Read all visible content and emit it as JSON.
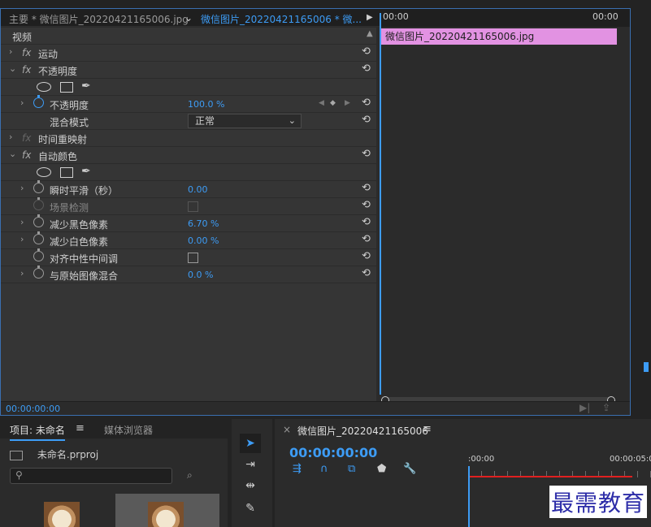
{
  "ec_tabs": {
    "master": "主要 * 微信图片_20220421165006.jpg",
    "sequence": "微信图片_20220421165006 * 微...",
    "dropdown_arrow": "⌄",
    "play_arrow": "▶"
  },
  "ruler": {
    "start": "00:00",
    "end": "00:00"
  },
  "section": {
    "video_label": "视频"
  },
  "effects": {
    "motion": "运动",
    "opacity": "不透明度",
    "opacity_prop": "不透明度",
    "opacity_value": "100.0 %",
    "blend_mode_label": "混合模式",
    "blend_mode_value": "正常",
    "time_remap": "时间重映射",
    "auto_color": "自动颜色",
    "instant_smooth": "瞬时平滑（秒）",
    "instant_smooth_value": "0.00",
    "scene_detect": "场景检测",
    "reduce_black": "减少黑色像素",
    "reduce_black_value": "6.70 %",
    "reduce_white": "减少白色像素",
    "reduce_white_value": "0.00 %",
    "snap_neutral": "对齐中性中间调",
    "blend_original": "与原始图像混合",
    "blend_original_value": "0.0 %",
    "fx_label": "fx"
  },
  "clip": {
    "name": "微信图片_20220421165006.jpg"
  },
  "status": {
    "timecode": "00:00:00:00"
  },
  "project": {
    "tab_project": "项目: 未命名",
    "tab_menu": "≡",
    "tab_media": "媒体浏览器",
    "file_name": "未命名.prproj"
  },
  "timeline": {
    "close": "×",
    "tab_name": "微信图片_20220421165006",
    "tab_menu": "≡",
    "timecode": "00:00:00:00",
    "ruler_start": ":00:00",
    "ruler_next": "00:00:05:0"
  },
  "watermark": "最需教育",
  "colors": {
    "accent": "#3d9cf5",
    "clip": "#e292e2",
    "panel": "#353535",
    "red": "#e02020"
  }
}
